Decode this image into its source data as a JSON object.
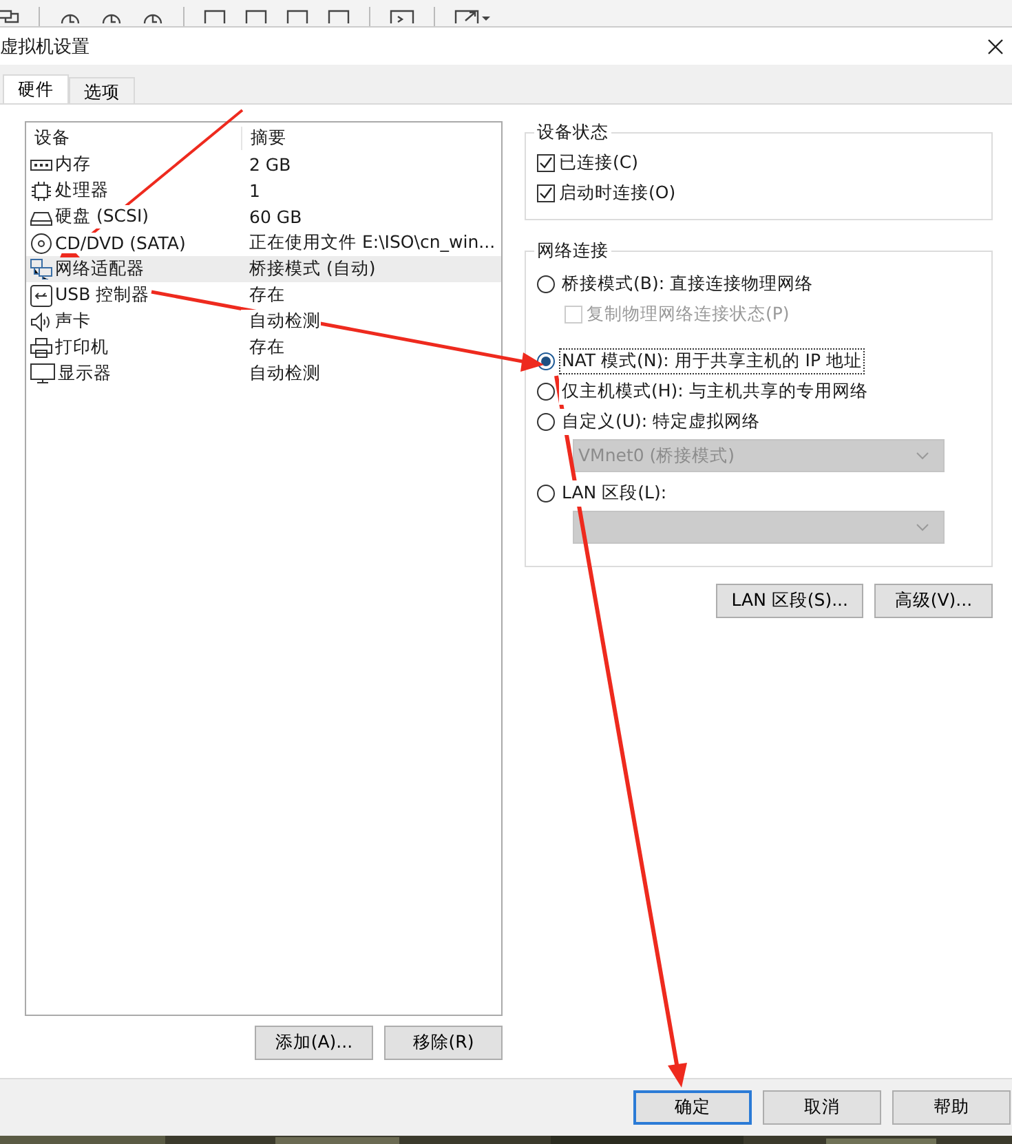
{
  "window": {
    "title": "虚拟机设置"
  },
  "tabs": [
    {
      "label": "硬件",
      "selected": true
    },
    {
      "label": "选项",
      "selected": false
    }
  ],
  "device_list": {
    "columns": [
      "设备",
      "摘要"
    ],
    "rows": [
      {
        "device": "内存",
        "summary": "2 GB",
        "selected": false
      },
      {
        "device": "处理器",
        "summary": "1",
        "selected": false
      },
      {
        "device": "硬盘 (SCSI)",
        "summary": "60 GB",
        "selected": false
      },
      {
        "device": "CD/DVD (SATA)",
        "summary": "正在使用文件 E:\\ISO\\cn_win...",
        "selected": false
      },
      {
        "device": "网络适配器",
        "summary": "桥接模式 (自动)",
        "selected": true
      },
      {
        "device": "USB 控制器",
        "summary": "存在",
        "selected": false
      },
      {
        "device": "声卡",
        "summary": "自动检测",
        "selected": false
      },
      {
        "device": "打印机",
        "summary": "存在",
        "selected": false
      },
      {
        "device": "显示器",
        "summary": "自动检测",
        "selected": false
      }
    ]
  },
  "list_buttons": [
    "添加(A)...",
    "移除(R)"
  ],
  "device_status": {
    "title": "设备状态",
    "options": [
      {
        "label": "已连接(C)",
        "checked": true
      },
      {
        "label": "启动时连接(O)",
        "checked": true
      }
    ]
  },
  "network_connection": {
    "title": "网络连接",
    "options": [
      {
        "kind": "radio",
        "label": "桥接模式(B): 直接连接物理网络",
        "selected": false
      },
      {
        "kind": "checkbox",
        "label": "复制物理网络连接状态(P)",
        "checked": false,
        "disabled": true
      },
      {
        "kind": "radio",
        "label": "NAT 模式(N): 用于共享主机的 IP 地址",
        "selected": true
      },
      {
        "kind": "radio",
        "label": "仅主机模式(H): 与主机共享的专用网络",
        "selected": false
      },
      {
        "kind": "radio",
        "label": "自定义(U): 特定虚拟网络",
        "selected": false
      },
      {
        "kind": "dropdown",
        "value": "VMnet0 (桥接模式)",
        "disabled": true
      },
      {
        "kind": "radio",
        "label": "LAN 区段(L):",
        "selected": false
      },
      {
        "kind": "dropdown",
        "disabled": true
      }
    ]
  },
  "network_buttons": [
    "LAN 区段(S)...",
    "高级(V)..."
  ],
  "footer_buttons": [
    {
      "label": "确定",
      "focused": true
    },
    {
      "label": "取消",
      "focused": false
    },
    {
      "label": "帮助",
      "focused": false
    }
  ]
}
